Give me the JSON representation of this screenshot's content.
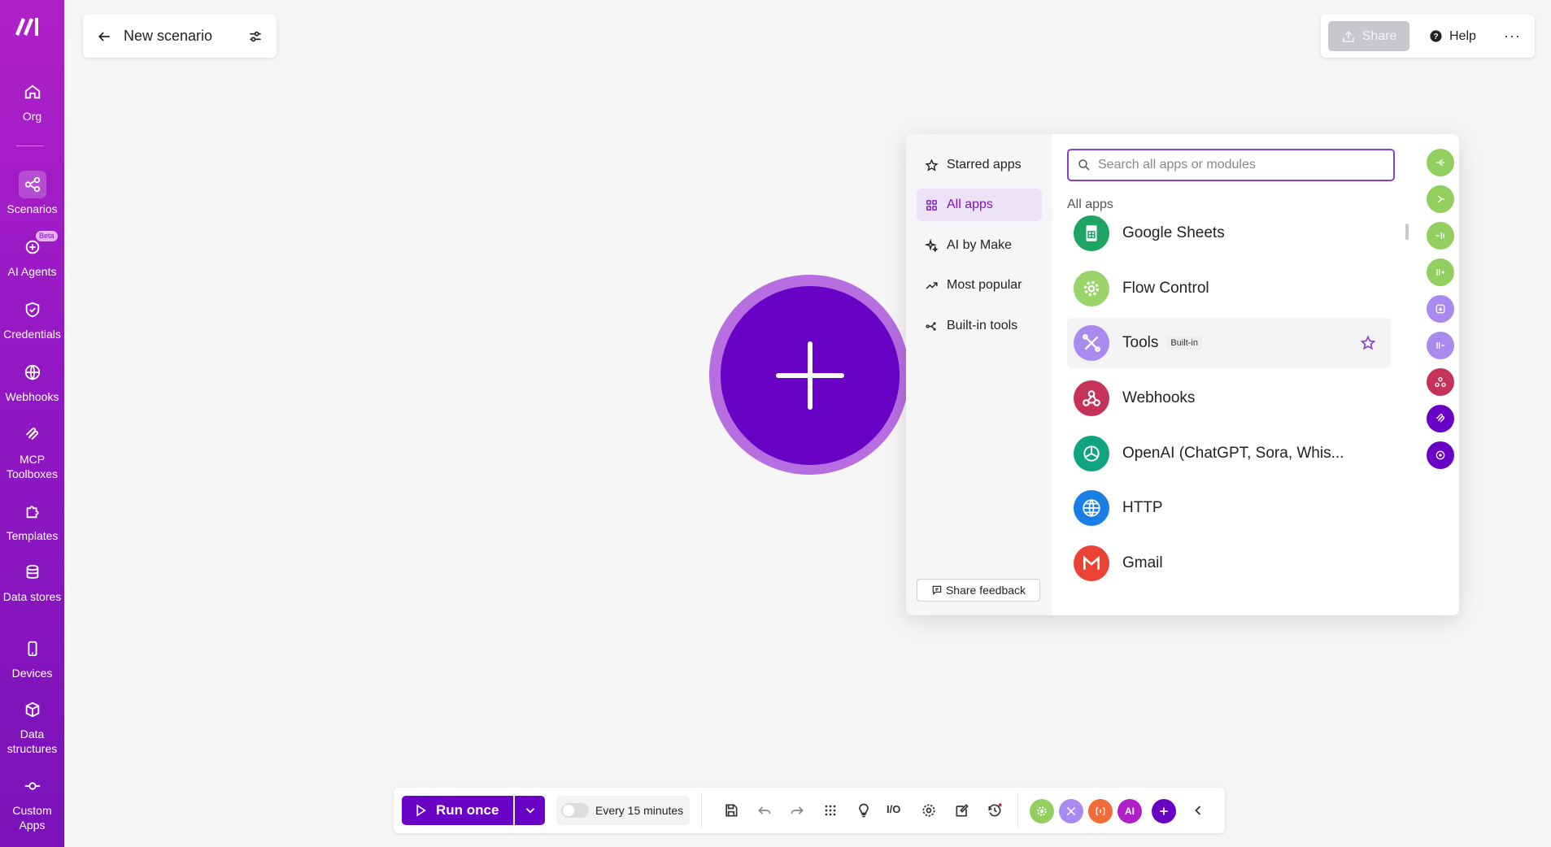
{
  "sidebar": {
    "items": [
      {
        "label": "Org",
        "icon": "home-icon"
      },
      {
        "label": "Scenarios",
        "icon": "scenarios-icon"
      },
      {
        "label": "AI Agents",
        "icon": "ai-agents-icon",
        "badge": "Beta"
      },
      {
        "label": "Credentials",
        "icon": "shield-check-icon"
      },
      {
        "label": "Webhooks",
        "icon": "globe-icon"
      },
      {
        "label": "MCP Toolboxes",
        "icon": "mcp-icon"
      },
      {
        "label": "Templates",
        "icon": "puzzle-icon"
      },
      {
        "label": "Data stores",
        "icon": "database-icon"
      },
      {
        "label": "Devices",
        "icon": "mobile-icon"
      },
      {
        "label": "Data structures",
        "icon": "cube-icon"
      },
      {
        "label": "Custom Apps",
        "icon": "commit-icon"
      }
    ]
  },
  "header": {
    "scenario_title": "New scenario",
    "share_label": "Share",
    "help_label": "Help",
    "more_label": "···"
  },
  "panel": {
    "categories": [
      {
        "label": "Starred apps",
        "icon": "star-icon"
      },
      {
        "label": "All apps",
        "icon": "grid-icon",
        "active": true
      },
      {
        "label": "AI by Make",
        "icon": "sparkle-icon"
      },
      {
        "label": "Most popular",
        "icon": "trending-icon"
      },
      {
        "label": "Built-in tools",
        "icon": "branch-icon"
      }
    ],
    "feedback_label": "Share feedback",
    "search_placeholder": "Search all apps or modules",
    "list_title": "All apps",
    "apps": [
      {
        "name": "Google Sheets",
        "color": "#1fa463"
      },
      {
        "name": "Flow Control",
        "color": "#9bd46a"
      },
      {
        "name": "Tools",
        "color": "#a98bf0",
        "badge": "Built-in"
      },
      {
        "name": "Webhooks",
        "color": "#c5335b"
      },
      {
        "name": "OpenAI (ChatGPT, Sora, Whis...",
        "color": "#10a37f"
      },
      {
        "name": "HTTP",
        "color": "#1a7ee5"
      },
      {
        "name": "Gmail",
        "color": "#ea4335"
      }
    ],
    "rail_colors": [
      "#93cf5f",
      "#93cf5f",
      "#93cf5f",
      "#93cf5f",
      "#a98bf0",
      "#a98bf0",
      "#c5335b",
      "#6a02c6",
      "#6a02c6"
    ]
  },
  "toolbar": {
    "run_label": "Run once",
    "schedule_label": "Every 15 minutes",
    "io_label": "I/O",
    "ai_label": "AI"
  }
}
